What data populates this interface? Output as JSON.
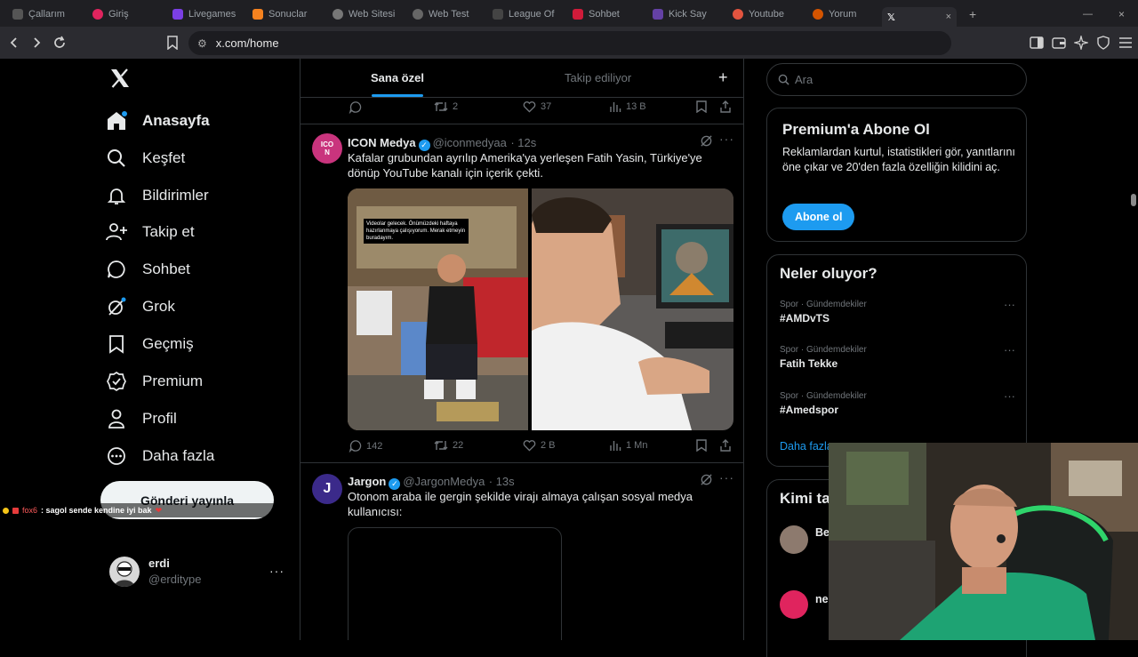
{
  "browser": {
    "tabs": [
      "Çallarım",
      "Giriş",
      "Livegames",
      "Sonuclar",
      "Web Sitesi",
      "Web Test",
      "League Of",
      "Sohbet",
      "Kick Say",
      "Youtube",
      "Yorum",
      ""
    ],
    "url": "x.com/home"
  },
  "nav": {
    "items": [
      {
        "label": "Anasayfa",
        "icon": "home-icon"
      },
      {
        "label": "Keşfet",
        "icon": "search-icon"
      },
      {
        "label": "Bildirimler",
        "icon": "bell-icon"
      },
      {
        "label": "Takip et",
        "icon": "add-user-icon"
      },
      {
        "label": "Sohbet",
        "icon": "chat-icon"
      },
      {
        "label": "Grok",
        "icon": "grok-icon"
      },
      {
        "label": "Geçmiş",
        "icon": "bookmark-icon"
      },
      {
        "label": "Premium",
        "icon": "verified-icon"
      },
      {
        "label": "Profil",
        "icon": "person-icon"
      },
      {
        "label": "Daha fazla",
        "icon": "more-circle-icon"
      }
    ],
    "post_button": "Gönderi yayınla",
    "account": {
      "name": "erdi",
      "handle": "@erditype"
    }
  },
  "stream_chat": {
    "user": "fox6",
    "message": ": sagol sende kendine iyi bak"
  },
  "feed": {
    "tabs": [
      "Sana özel",
      "Takip ediliyor"
    ],
    "prev_actions": {
      "retweets": "2",
      "likes": "37",
      "views": "13 B"
    },
    "tweets": [
      {
        "avatar_text": "ICON",
        "name": "ICON Medya",
        "handle": "@iconmedyaa",
        "time": "· 12s",
        "text": "Kafalar grubundan ayrılıp Amerika'ya yerleşen Fatih Yasin, Türkiye'ye dönüp YouTube kanalı için içerik çekti.",
        "image_caption": "Videolar gelecek. Önümüzdeki haftaya hazırlanmaya çalışıyorum. Merak etmeyin buradayım.",
        "replies": "142",
        "retweets": "22",
        "likes": "2 B",
        "views": "1 Mn"
      },
      {
        "avatar_text": "J",
        "name": "Jargon",
        "handle": "@JargonMedya",
        "time": "· 13s",
        "text": "Otonom araba ile gergin şekilde virajı almaya çalışan sosyal medya kullanıcısı:"
      }
    ]
  },
  "sidebar": {
    "search_placeholder": "Ara",
    "premium": {
      "title": "Premium'a Abone Ol",
      "text": "Reklamlardan kurtul, istatistikleri gör, yanıtlarını öne çıkar ve 20'den fazla özelliğin kilidini aç.",
      "button": "Abone ol"
    },
    "trends": {
      "title": "Neler oluyor?",
      "items": [
        {
          "meta": "Spor · Gündemdekiler",
          "name": "#AMDvTS"
        },
        {
          "meta": "Spor · Gündemdekiler",
          "name": "Fatih Tekke"
        },
        {
          "meta": "Spor · Gündemdekiler",
          "name": "#Amedspor"
        }
      ],
      "more": "Daha fazla"
    },
    "who_to_follow": {
      "title": "Kimi ta",
      "first": "Be",
      "second": "ne"
    }
  },
  "colors": {
    "accent": "#1d9bf0",
    "background": "#000000",
    "border": "#2f3336",
    "muted": "#71767b"
  }
}
